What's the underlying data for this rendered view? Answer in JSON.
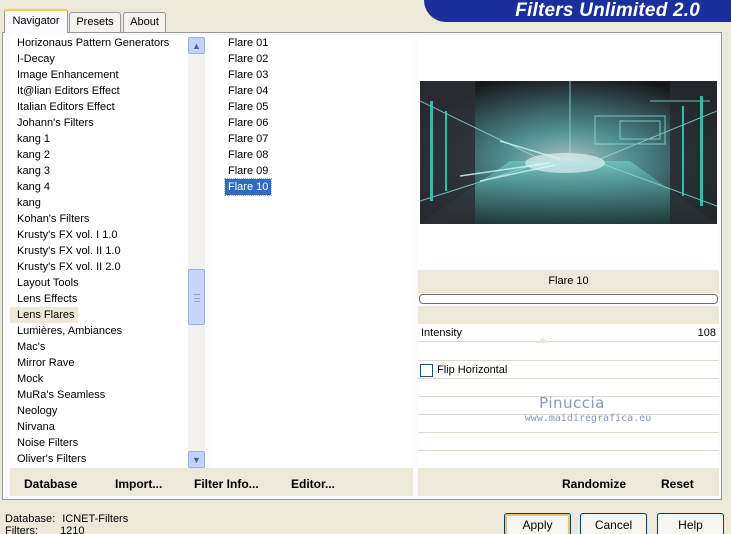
{
  "tabs": [
    {
      "label": "Navigator",
      "active": true
    },
    {
      "label": "Presets",
      "active": false
    },
    {
      "label": "About",
      "active": false
    }
  ],
  "logo_text": "Filters Unlimited 2.0",
  "categories": [
    "Horizonaus Pattern Generators",
    "I-Decay",
    "Image Enhancement",
    "It@lian Editors Effect",
    "Italian Editors Effect",
    "Johann's Filters",
    "kang 1",
    "kang 2",
    "kang 3",
    "kang 4",
    "kang",
    "Kohan's Filters",
    "Krusty's FX vol. I 1.0",
    "Krusty's FX vol. II 1.0",
    "Krusty's FX vol. II 2.0",
    "Layout Tools",
    "Lens Effects",
    "Lens Flares",
    "Lumières, Ambiances",
    "Mac's",
    "Mirror Rave",
    "Mock",
    "MuRa's Seamless",
    "Neology",
    "Nirvana",
    "Noise Filters",
    "Oliver's Filters"
  ],
  "selected_category": "Lens Flares",
  "filters": [
    "Flare 01",
    "Flare 02",
    "Flare 03",
    "Flare 04",
    "Flare 05",
    "Flare 06",
    "Flare 07",
    "Flare 08",
    "Flare 09",
    "Flare 10"
  ],
  "selected_filter": "Flare 10",
  "preview": {
    "filter_name": "Flare 10"
  },
  "params": {
    "intensity_label": "Intensity",
    "intensity_value": "108",
    "flip_label": "Flip Horizontal",
    "flip_checked": false
  },
  "watermark": {
    "name": "Pinuccia",
    "url": "www.maidiregrafica.eu"
  },
  "toolbar": {
    "database": "Database",
    "import": "Import...",
    "filter_info": "Filter Info...",
    "editor": "Editor...",
    "randomize": "Randomize",
    "reset": "Reset"
  },
  "status": {
    "database_label": "Database:",
    "database_value": "ICNET-Filters",
    "filters_label": "Filters:",
    "filters_value": "1210"
  },
  "buttons": {
    "apply": "Apply",
    "cancel": "Cancel",
    "help": "Help"
  },
  "colors": {
    "selection": "#316ac5",
    "logo_bg": "#1b2f9a",
    "window_bg": "#ece9d8"
  }
}
